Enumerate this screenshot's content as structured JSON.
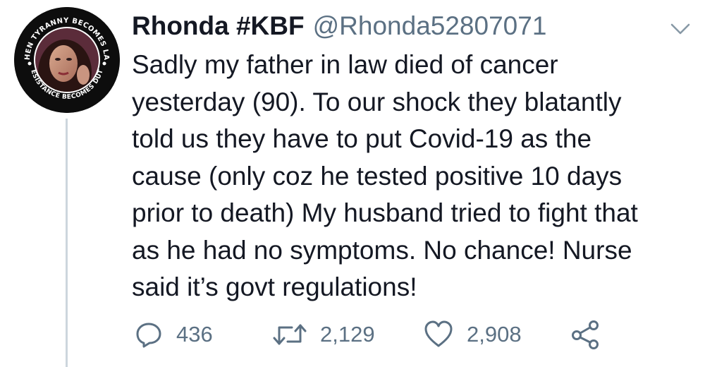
{
  "user": {
    "display_name": "Rhonda #KBF",
    "handle": "@Rhonda52807071",
    "avatar_badge_top": "WHEN TYRANNY BECOMES LAW",
    "avatar_badge_bottom": "RESISTANCE BECOMES DUTY"
  },
  "tweet": {
    "lines": [
      "Sadly my father in law died of cancer",
      "yesterday (90). To our shock they blatantly",
      "told us they have to put Covid-19 as the",
      "cause (only coz he tested positive 10 days",
      "prior to death) My husband tried to fight that",
      "as he had no symptoms. No chance! Nurse",
      "said it’s govt regulations!"
    ]
  },
  "actions": {
    "reply": {
      "icon": "reply-icon",
      "count": "436"
    },
    "retweet": {
      "icon": "retweet-icon",
      "count": "2,129"
    },
    "like": {
      "icon": "heart-icon",
      "count": "2,908"
    },
    "share": {
      "icon": "share-icon"
    },
    "menu": {
      "icon": "chevron-down-icon"
    }
  },
  "colors": {
    "text": "#141823",
    "secondary": "#5b7083",
    "thread_line": "#cdd6dd"
  }
}
